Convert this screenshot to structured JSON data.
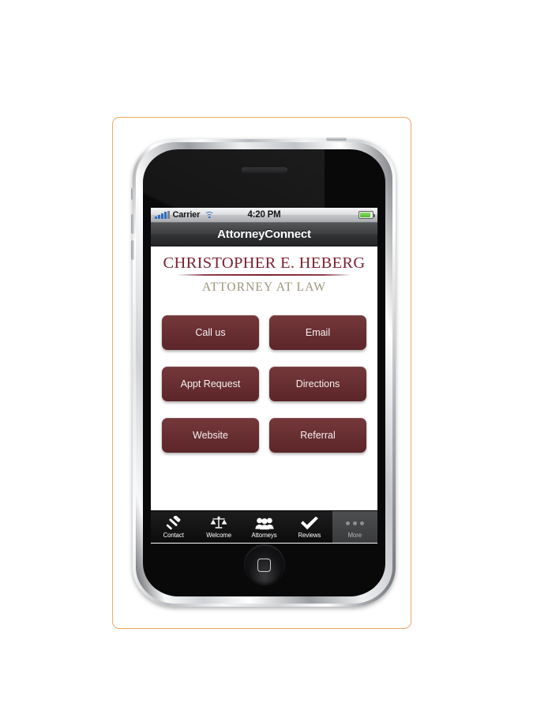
{
  "status_bar": {
    "signal_icon": "signal-bars-icon",
    "carrier": "Carrier",
    "wifi_icon": "wifi-icon",
    "time": "4:20 PM",
    "battery_icon": "battery-icon"
  },
  "nav_bar": {
    "title": "AttorneyConnect"
  },
  "logo": {
    "name": "CHRISTOPHER  E.  HEBERG",
    "subtitle": "ATTORNEY AT LAW",
    "name_color": "#7c2230",
    "subtitle_color": "#9b9479"
  },
  "buttons": [
    {
      "label": "Call us"
    },
    {
      "label": "Email"
    },
    {
      "label": "Appt Request"
    },
    {
      "label": "Directions"
    },
    {
      "label": "Website"
    },
    {
      "label": "Referral"
    }
  ],
  "button_color": "#6b3134",
  "tab_bar": [
    {
      "label": "Contact",
      "icon": "gavel-icon",
      "selected": false
    },
    {
      "label": "Welcome",
      "icon": "scales-icon",
      "selected": false
    },
    {
      "label": "Attorneys",
      "icon": "people-icon",
      "selected": false
    },
    {
      "label": "Reviews",
      "icon": "check-icon",
      "selected": false
    },
    {
      "label": "More",
      "icon": "ellipsis-icon",
      "selected": true
    }
  ],
  "frame": {
    "border_color": "#f0a861"
  }
}
